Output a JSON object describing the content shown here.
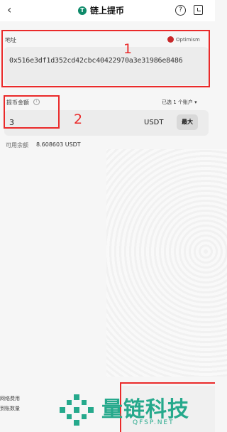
{
  "header": {
    "back_icon": "chevron-left-icon",
    "coin_badge": "T",
    "title": "链上提币",
    "help_icon": "help-circle-icon",
    "history_icon": "history-icon"
  },
  "address": {
    "label": "地址",
    "network_label": "Optimism",
    "value": "0x516e3df1d352cd42cbc40422970a3e31986e8486"
  },
  "amount": {
    "label": "提币金额",
    "account_selector": "已选 1 个账户 ▾",
    "value": "3",
    "unit": "USDT",
    "max_label": "最大"
  },
  "balance": {
    "label": "可用余额",
    "value": "8.608603 USDT"
  },
  "footer": {
    "fee_label": "网络费用",
    "receive_label": "到账数量"
  },
  "annotations": {
    "box1_number": "1",
    "box2_number": "2",
    "color": "#ea2a2a"
  },
  "watermark": {
    "text": "量链科技",
    "url": "QFSP.NET",
    "color": "#26a98c"
  }
}
